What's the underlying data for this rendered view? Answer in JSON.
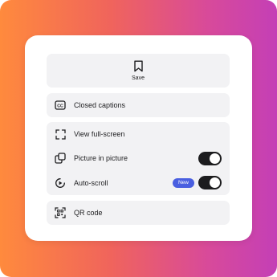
{
  "colors": {
    "sheet_background": "#ffffff",
    "row_background": "#f2f2f4",
    "toggle_on": "#1c1c1e",
    "badge_background": "#4a5fe0",
    "text": "#1c1c1e"
  },
  "save": {
    "icon": "bookmark-icon",
    "label": "Save"
  },
  "captions": {
    "icon": "closed-captions-icon",
    "label": "Closed captions"
  },
  "view_group": {
    "full_screen": {
      "icon": "fullscreen-icon",
      "label": "View full-screen"
    },
    "picture_in_picture": {
      "icon": "picture-in-picture-icon",
      "label": "Picture in picture",
      "toggle_on": true
    },
    "auto_scroll": {
      "icon": "auto-scroll-icon",
      "label": "Auto-scroll",
      "badge": "New",
      "toggle_on": true
    }
  },
  "qr": {
    "icon": "qr-code-icon",
    "label": "QR code"
  }
}
